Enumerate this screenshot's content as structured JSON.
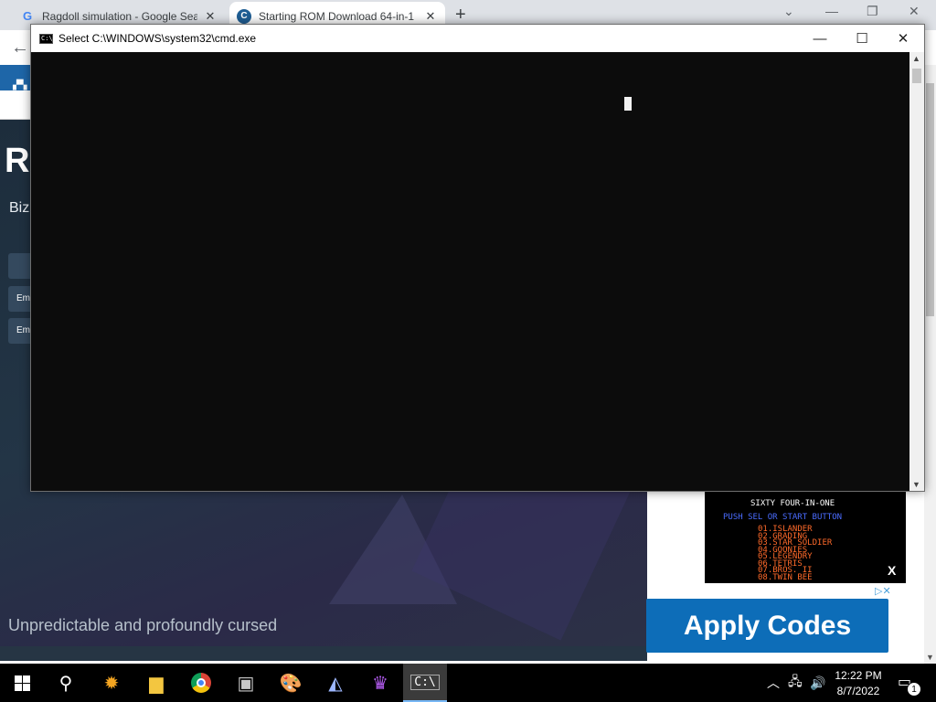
{
  "browser": {
    "tabs": [
      {
        "title": "Ragdoll simulation - Google Sea",
        "favicon": "google-g-icon"
      },
      {
        "title": "Starting ROM Download 64-in-1",
        "favicon": "site-c-icon"
      }
    ],
    "new_tab_glyph": "+",
    "window_controls": {
      "collapse": "⌄",
      "minimize": "—",
      "restore": "❐",
      "close": "✕"
    }
  },
  "page": {
    "hero_title": "Re",
    "hero_subtitle": "Bizl",
    "side_buttons": [
      "",
      "Em",
      "Em"
    ],
    "tagline": "Unpredictable and profoundly cursed",
    "ad": {
      "screenshot_title": "SIXTY FOUR-IN-ONE",
      "screenshot_prompt": "PUSH SEL OR START BUTTON",
      "games": [
        "01.ISLANDER",
        "02.GRADING",
        "03.STAR SOLDIER",
        "04.GOONIES",
        "05.LEGENDRY",
        "06.TETRIS",
        "07.BROS. II",
        "08.TWIN BEE"
      ],
      "close_glyph": "X",
      "ad_markers": "▷✕",
      "apply_label": "Apply Codes"
    }
  },
  "cmd": {
    "title": "Select C:\\WINDOWS\\system32\\cmd.exe",
    "icon_text": "C:\\_",
    "controls": {
      "minimize": "—",
      "maximize": "☐",
      "close": "✕"
    }
  },
  "taskbar": {
    "clock_time": "12:22 PM",
    "clock_date": "8/7/2022",
    "notification_count": "1",
    "tray": {
      "chevron": "︿",
      "network": "🖧",
      "volume": "🔊"
    }
  },
  "colors": {
    "cmd_background": "#0c0c0c",
    "hero_background": "#233546",
    "site_header": "#1e66a8",
    "apply_button": "#0d6db8",
    "taskbar": "#000000"
  }
}
